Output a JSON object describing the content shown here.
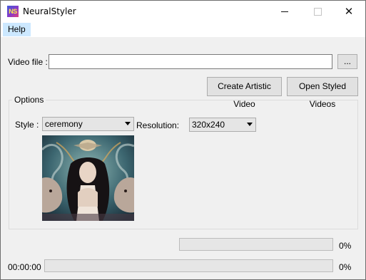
{
  "window": {
    "title": "NeuralStyler",
    "app_icon_text": "NS"
  },
  "menu": {
    "items": [
      {
        "label": "Help"
      }
    ]
  },
  "video_file": {
    "label": "Video file :",
    "value": "",
    "browse_label": "..."
  },
  "actions": {
    "create_label": "Create Artistic Video",
    "open_label": "Open Styled Videos"
  },
  "options": {
    "title": "Options",
    "style_label": "Style :",
    "style_value": "ceremony",
    "resolution_label": "Resolution:",
    "resolution_value": "320x240"
  },
  "progress": {
    "first": {
      "value_percent": 0,
      "text": "0%"
    },
    "second": {
      "value_percent": 0,
      "text": "0%",
      "time": "00:00:00"
    }
  },
  "colors": {
    "menu_highlight": "#cce8ff",
    "window_bg": "#f0f0f0",
    "progress_fill": "#06b025"
  }
}
